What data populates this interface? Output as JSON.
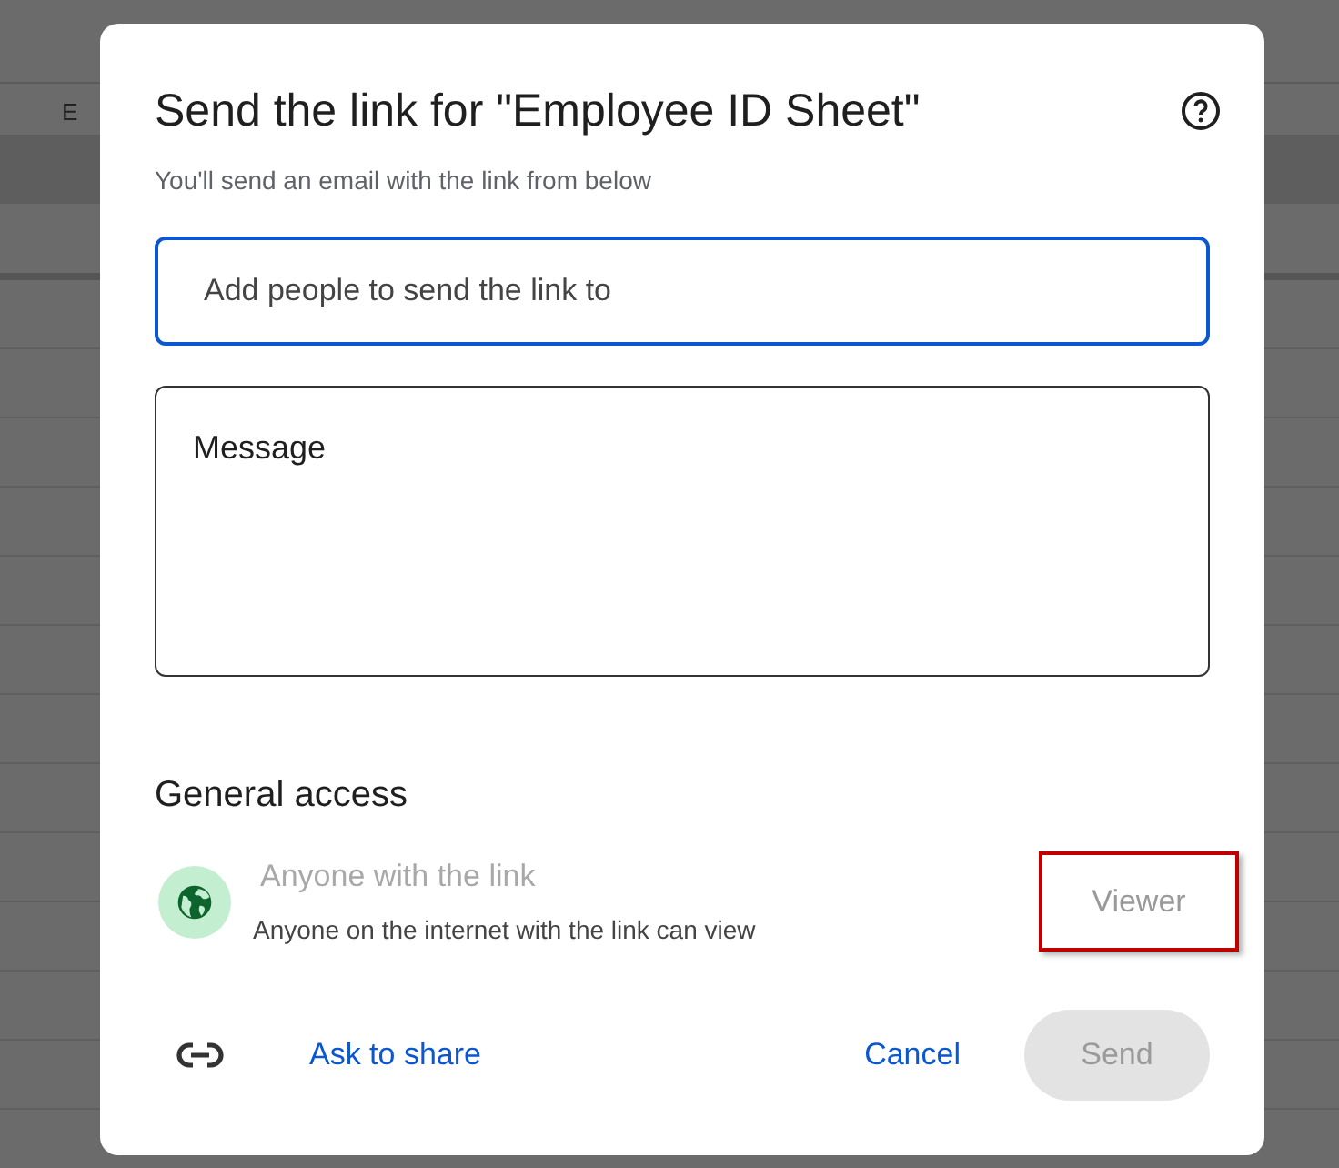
{
  "sheet": {
    "column_header": "E"
  },
  "dialog": {
    "title": "Send the link for \"Employee ID Sheet\"",
    "subtitle": "You'll send an email with the link from below",
    "recipients_field": {
      "placeholder": "Add people to send the link to",
      "focused": true
    },
    "message_field": {
      "placeholder": "Message"
    },
    "general_access": {
      "heading": "General access",
      "option": "Anyone with the link",
      "option_disabled": true,
      "description": "Anyone on the internet with the link can view",
      "role": "Viewer",
      "role_highlighted": true
    },
    "actions": {
      "ask_to_share": "Ask to share",
      "cancel": "Cancel",
      "send": {
        "label": "Send",
        "disabled": true
      }
    }
  }
}
